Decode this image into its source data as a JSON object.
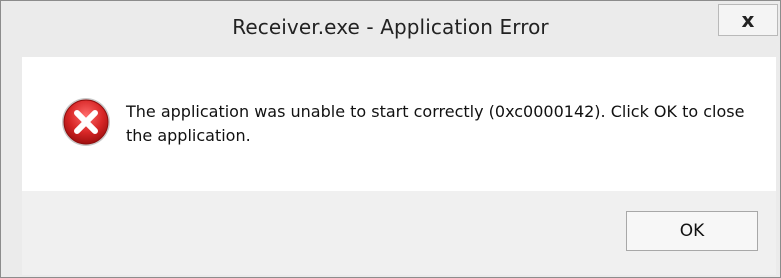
{
  "window": {
    "title": "Receiver.exe - Application Error",
    "close_label": "x"
  },
  "dialog": {
    "message": "The application was unable to start correctly (0xc0000142). Click OK to close the application.",
    "icon": "error-icon"
  },
  "buttons": {
    "ok_label": "OK"
  },
  "colors": {
    "error_red": "#d72626",
    "frame_gray": "#ebebeb"
  }
}
